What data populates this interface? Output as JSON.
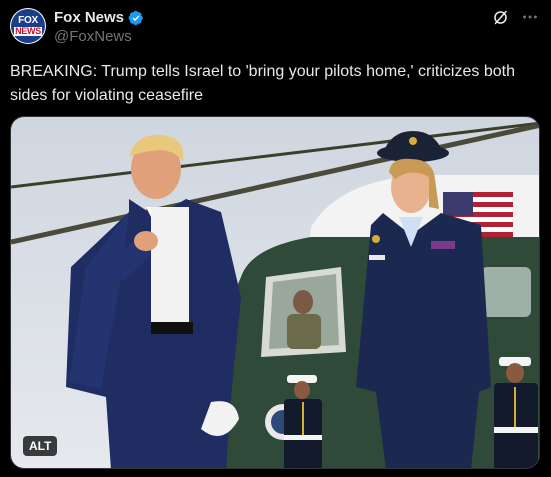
{
  "account": {
    "display_name": "Fox News",
    "handle": "@FoxNews",
    "avatar_icon": "fox-news-logo",
    "avatar_text_top": "FOX",
    "avatar_text_bottom": "NEWS",
    "verified": true,
    "verified_color": "#1d9bf0"
  },
  "header_icons": [
    "grok-icon",
    "more-options-icon"
  ],
  "post": {
    "text": "BREAKING: Trump tells Israel to 'bring your pilots home,' criticizes both sides for violating ceasefire"
  },
  "media": {
    "alt_badge_label": "ALT"
  },
  "colors": {
    "background": "#000000",
    "text_primary": "#e7e9ea",
    "text_secondary": "#71767b",
    "accent": "#1d9bf0"
  }
}
